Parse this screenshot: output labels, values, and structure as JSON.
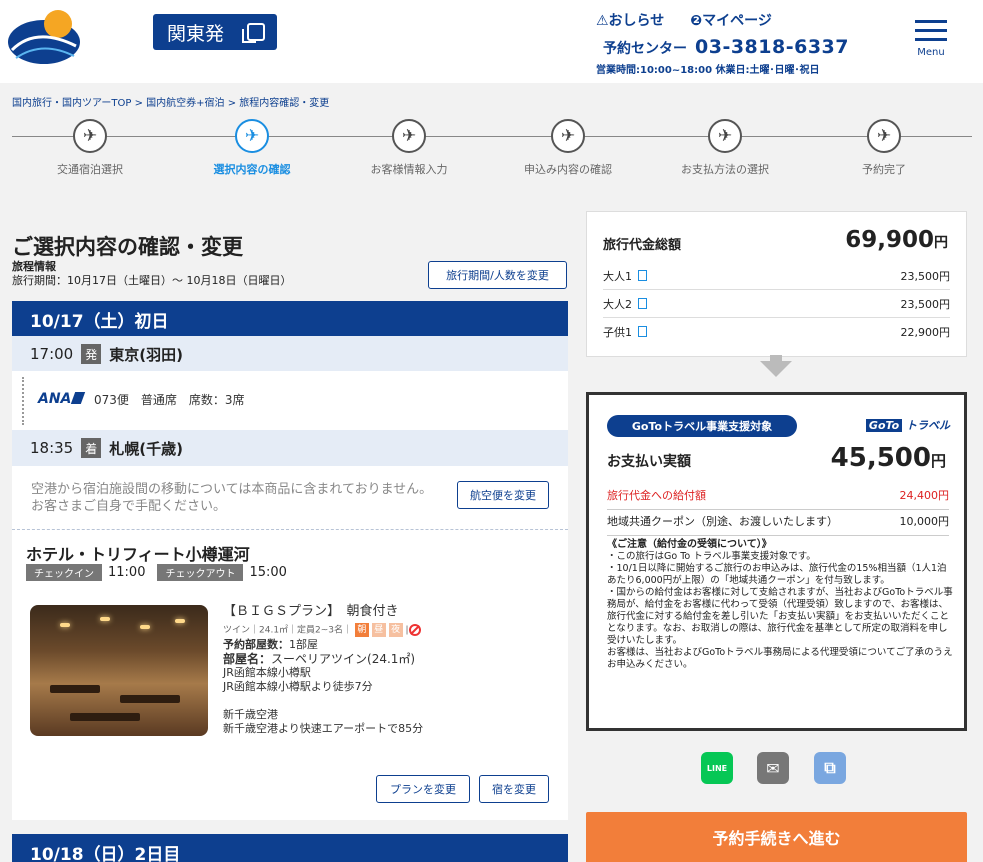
{
  "header": {
    "departure_label": "関東発",
    "notice_link": "⚠おしらせ",
    "mypage_link": "❷マイページ",
    "reservation_label": "予約センター",
    "phone": "03-3818-6337",
    "hours": "営業時間:10:00~18:00 休業日:土曜･日曜･祝日",
    "menu_label": "Menu"
  },
  "breadcrumb": "国内旅行・国内ツアーTOP > 国内航空券+宿泊 > 旅程内容確認・変更",
  "steps": [
    {
      "label": "交通宿泊選択"
    },
    {
      "label": "選択内容の確認"
    },
    {
      "label": "お客様情報入力"
    },
    {
      "label": "申込み内容の確認"
    },
    {
      "label": "お支払方法の選択"
    },
    {
      "label": "予約完了"
    }
  ],
  "page_title": "ご選択内容の確認・変更",
  "trip": {
    "info_heading": "旅程情報",
    "period": "旅行期間：10月17日（土曜日）～ 10月18日（日曜日）",
    "change_button": "旅行期間/人数を変更"
  },
  "day1": {
    "header": "10/17（土）初日",
    "depart_time": "17:00",
    "depart_badge": "発",
    "depart_place": "東京(羽田)",
    "airline": "ANA",
    "flight_info": "073便　普通席　席数：3席",
    "arrive_time": "18:35",
    "arrive_badge": "着",
    "arrive_place": "札幌(千歳)",
    "transfer_note_1": "空港から宿泊施設間の移動については本商品に含まれておりません。",
    "transfer_note_2": "お客さまご自身で手配ください。",
    "flight_change_button": "航空便を変更",
    "hotel_name": "ホテル・トリフィート小樽運河",
    "checkin_label": "チェックイン",
    "checkin_time": "11:00",
    "checkout_label": "チェックアウト",
    "checkout_time": "15:00",
    "plan": "【ＢＩＧＳプラン】　朝食付き",
    "room_meta": "ツイン｜24.1㎡｜定員2~3名｜",
    "meal_breakfast": "朝",
    "meal_lunch": "昼",
    "meal_dinner": "夜",
    "rooms_label": "予約部屋数：",
    "rooms_value": "1部屋",
    "roomname_label": "部屋名：",
    "roomname_value": "スーペリアツイン(24.1㎡)",
    "access_1": "JR函館本線小樽駅",
    "access_2": "JR函館本線小樽駅より徒歩7分",
    "access_3": "新千歳空港",
    "access_4": "新千歳空港より快速エアーポートで85分",
    "plan_change_button": "プランを変更",
    "hotel_change_button": "宿を変更"
  },
  "day2": {
    "header": "10/18（日）2日目"
  },
  "price": {
    "title": "旅行代金総額",
    "total": "69,900",
    "yen": "円",
    "rows": [
      {
        "label": "大人1",
        "value": "23,500円"
      },
      {
        "label": "大人2",
        "value": "23,500円"
      },
      {
        "label": "子供1",
        "value": "22,900円"
      }
    ]
  },
  "goto": {
    "badge": "GoToトラベル事業支援対象",
    "logo_text": "トラベル",
    "logo_mark": "GoTo",
    "pay_label": "お支払い実額",
    "pay_amount": "45,500",
    "yen": "円",
    "benefit_label": "旅行代金への給付額",
    "benefit_value": "24,400円",
    "coupon_label": "地域共通クーポン（別途、お渡しいたします）",
    "coupon_value": "10,000円",
    "caution_heading": "《ご注意（給付金の受領について）》",
    "caution_1": "・この旅行はGo To トラベル事業支援対象です。",
    "caution_2": "・10/1日以降に開始するご旅行のお申込みは、旅行代金の15%相当額（1人1泊あたり6,000円が上限）の「地域共通クーポン」を付与致します。",
    "caution_3": "・国からの給付金はお客様に対して支給されますが、当社およびGoToトラベル事務局が、給付金をお客様に代わって受領（代理受領）致しますので、お客様は、旅行代金に対する給付金を差し引いた「お支払い実額」をお支払いいただくこととなります。なお、お取消しの際は、旅行代金を基準として所定の取消料を申し受けいたします。",
    "caution_4": "お客様は、当社およびGoToトラベル事務局による代理受領についてご了承のうえお申込みください。"
  },
  "share": {
    "line": "LINE",
    "mail": "✉",
    "copy": "⧉"
  },
  "proceed_button": "予約手続きへ進む",
  "colors": {
    "brand": "#0d3f8f",
    "accent": "#1a8ee1",
    "cta": "#f27e3a",
    "line": "#06c755"
  }
}
